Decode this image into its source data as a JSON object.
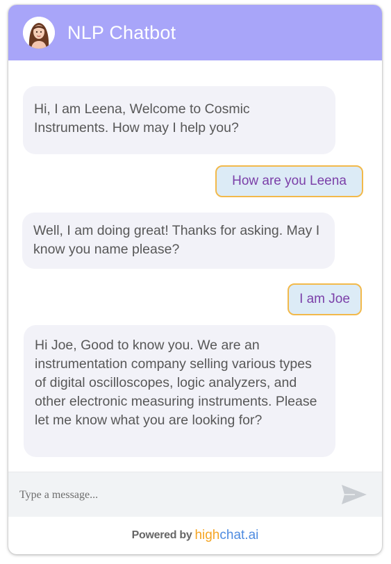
{
  "header": {
    "title": "NLP Chatbot",
    "avatar_icon": "woman-avatar-icon",
    "background": "#a8a5f9"
  },
  "messages": [
    {
      "sender": "bot",
      "text": "Hi, I am Leena, Welcome to Cosmic Instruments. How may I help you?"
    },
    {
      "sender": "user",
      "text": "How are you Leena"
    },
    {
      "sender": "bot",
      "text": "Well, I am doing great! Thanks for asking. May I know you name please?"
    },
    {
      "sender": "user",
      "text": "I am Joe"
    },
    {
      "sender": "bot",
      "text": "Hi Joe, Good to know you. We are an instrumentation company selling various types of digital oscilloscopes, logic analyzers, and other electronic measuring instruments. Please let me know what you are looking for?"
    }
  ],
  "composer": {
    "placeholder": "Type a message...",
    "value": "",
    "send_icon": "send-icon"
  },
  "footer": {
    "powered_by": "Powered by",
    "brand_part1": "high",
    "brand_part2": "chat.ai"
  },
  "colors": {
    "user_bubble_bg": "#dcebf6",
    "user_bubble_border": "#f2b94a",
    "user_text": "#7b3fa8",
    "bot_bubble_bg": "#f2f2f8",
    "brand_orange": "#f5a523",
    "brand_blue": "#4e8be0"
  }
}
